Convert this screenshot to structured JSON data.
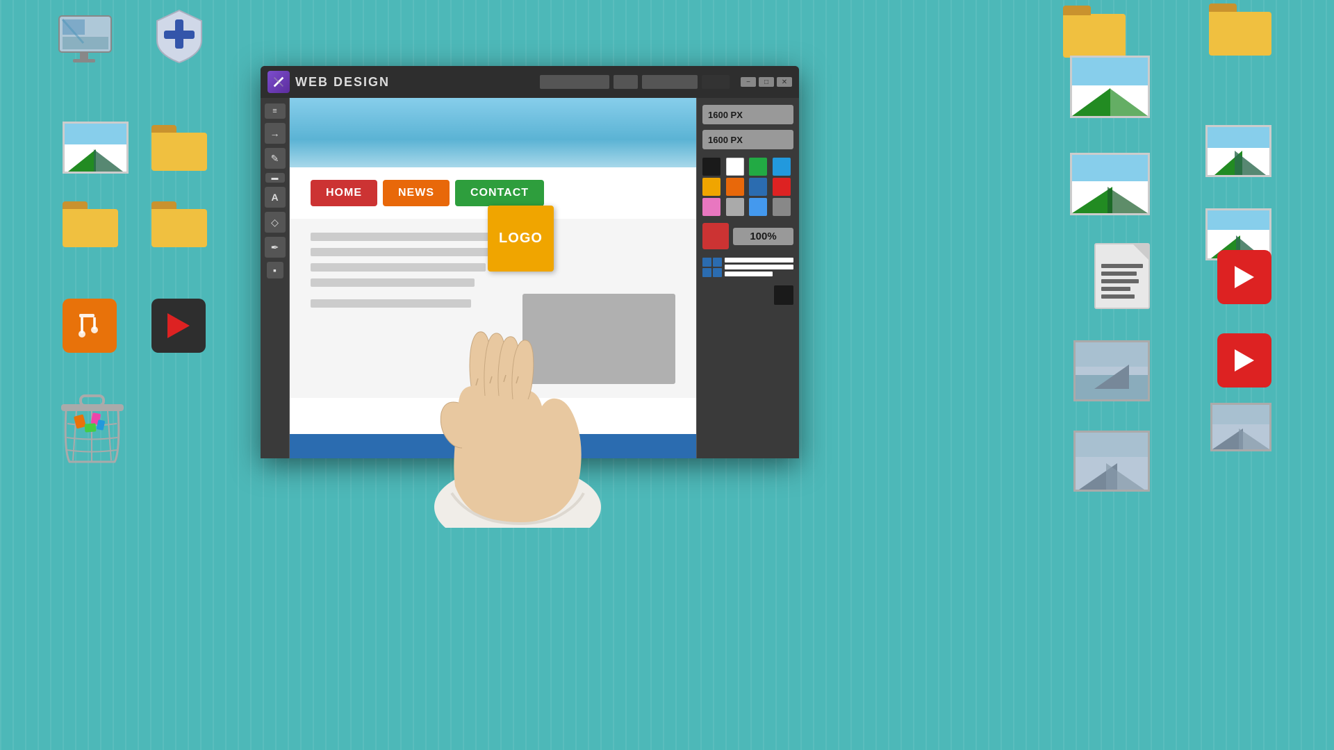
{
  "background": {
    "color": "#4db8b8"
  },
  "window": {
    "title": "WEB DESIGN",
    "icon_alt": "web-design-icon",
    "min_btn": "−",
    "max_btn": "□",
    "close_btn": "✕",
    "dim_width": "1600 PX",
    "dim_height": "1600 PX",
    "zoom": "100%"
  },
  "nav_buttons": [
    {
      "label": "HOME",
      "color": "#cc3333"
    },
    {
      "label": "NEWS",
      "color": "#e8680a"
    },
    {
      "label": "CONTACT",
      "color": "#2e9e3d"
    }
  ],
  "logo_label": "LOGO",
  "colors_palette": [
    "#1a1a1a",
    "#ffffff",
    "#22aa44",
    "#2299dd",
    "#f0a500",
    "#e8680a",
    "#2b6cb0",
    "#dd2222",
    "#e877c0",
    "#aaaaaa",
    "#4499ee",
    "#888888"
  ],
  "toolbar": {
    "tools": [
      "≡",
      "→",
      "✎",
      "▬",
      "A",
      "◇",
      "✒",
      "▪"
    ]
  }
}
